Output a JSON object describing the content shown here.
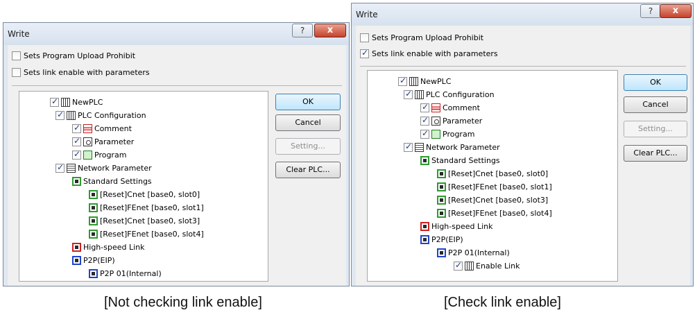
{
  "left_dialog": {
    "title": "Write",
    "help_button": "?",
    "close_button": "x",
    "options": [
      {
        "label": "Sets Program Upload Prohibit",
        "checked": false
      },
      {
        "label": "Sets link enable with parameters",
        "checked": false
      }
    ],
    "tree": [
      {
        "label": "NewPLC",
        "checked": true,
        "icon": "plc-icon"
      },
      {
        "label": "PLC Configuration",
        "checked": true,
        "icon": "plc-config-icon"
      },
      {
        "label": "Comment",
        "checked": true,
        "icon": "comment-icon"
      },
      {
        "label": "Parameter",
        "checked": true,
        "icon": "parameter-icon"
      },
      {
        "label": "Program",
        "checked": true,
        "icon": "program-icon"
      },
      {
        "label": "Network Parameter",
        "checked": true,
        "icon": "network-icon"
      },
      {
        "label": "Standard Settings",
        "icon": "module-green-icon"
      },
      {
        "label": "[Reset]Cnet [base0, slot0]",
        "icon": "module-green-icon"
      },
      {
        "label": "[Reset]FEnet [base0, slot1]",
        "icon": "module-green-icon"
      },
      {
        "label": "[Reset]Cnet [base0, slot3]",
        "icon": "module-green-icon"
      },
      {
        "label": "[Reset]FEnet [base0, slot4]",
        "icon": "module-green-icon"
      },
      {
        "label": "High-speed Link",
        "icon": "module-red-icon"
      },
      {
        "label": "P2P(EIP)",
        "icon": "module-blue-icon"
      },
      {
        "label": "P2P 01(Internal)",
        "icon": "module-blue-icon"
      }
    ],
    "buttons": {
      "ok": "OK",
      "cancel": "Cancel",
      "setting": "Setting...",
      "clear_plc": "Clear PLC..."
    }
  },
  "right_dialog": {
    "title": "Write",
    "help_button": "?",
    "close_button": "x",
    "options": [
      {
        "label": "Sets Program Upload Prohibit",
        "checked": false
      },
      {
        "label": "Sets link enable with parameters",
        "checked": true
      }
    ],
    "tree": [
      {
        "label": "NewPLC",
        "checked": true,
        "icon": "plc-icon"
      },
      {
        "label": "PLC Configuration",
        "checked": true,
        "icon": "plc-config-icon"
      },
      {
        "label": "Comment",
        "checked": true,
        "icon": "comment-icon"
      },
      {
        "label": "Parameter",
        "checked": true,
        "icon": "parameter-icon"
      },
      {
        "label": "Program",
        "checked": true,
        "icon": "program-icon"
      },
      {
        "label": "Network Parameter",
        "checked": true,
        "icon": "network-icon"
      },
      {
        "label": "Standard Settings",
        "icon": "module-green-icon"
      },
      {
        "label": "[Reset]Cnet [base0, slot0]",
        "icon": "module-green-icon"
      },
      {
        "label": "[Reset]FEnet [base0, slot1]",
        "icon": "module-green-icon"
      },
      {
        "label": "[Reset]Cnet [base0, slot3]",
        "icon": "module-green-icon"
      },
      {
        "label": "[Reset]FEnet [base0, slot4]",
        "icon": "module-green-icon"
      },
      {
        "label": "High-speed Link",
        "icon": "module-red-icon"
      },
      {
        "label": "P2P(EIP)",
        "icon": "module-blue-icon"
      },
      {
        "label": "P2P 01(Internal)",
        "icon": "module-blue-icon"
      },
      {
        "label": "Enable Link",
        "checked": true,
        "icon": "enable-link-icon"
      }
    ],
    "buttons": {
      "ok": "OK",
      "cancel": "Cancel",
      "setting": "Setting...",
      "clear_plc": "Clear PLC..."
    }
  },
  "captions": {
    "left": "[Not checking link enable]",
    "right": "[Check link enable]"
  }
}
